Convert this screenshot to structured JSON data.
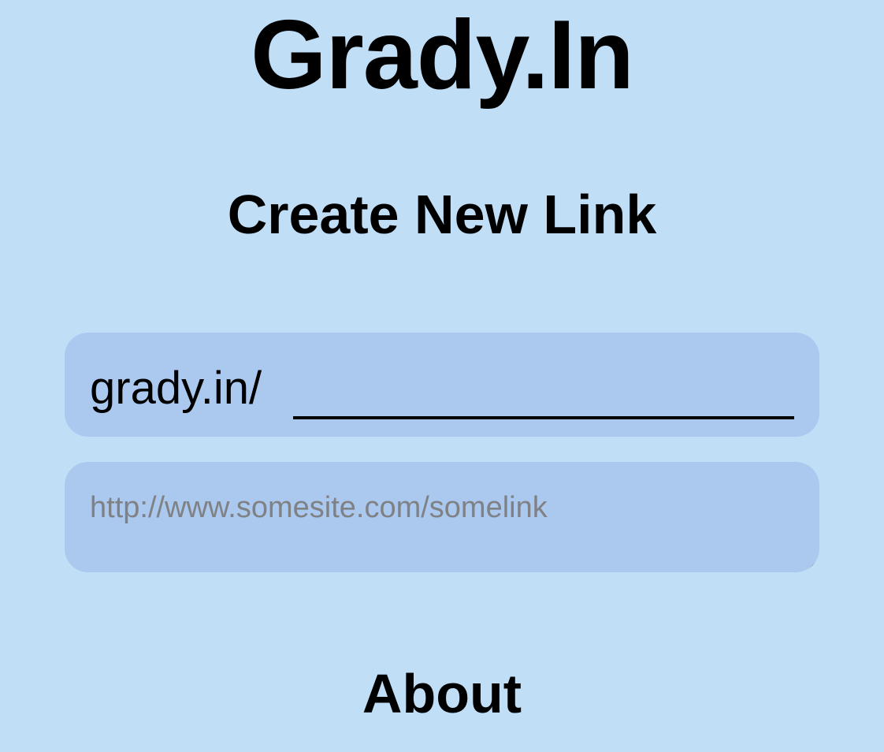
{
  "header": {
    "site_title": "Grady.In"
  },
  "create_form": {
    "heading": "Create New Link",
    "slug_prefix": "grady.in/",
    "slug_value": "",
    "url_placeholder": "http://www.somesite.com/somelink",
    "url_value": ""
  },
  "footer": {
    "about_label": "About"
  },
  "colors": {
    "background": "#c1def7",
    "field_background": "#abc8ee",
    "text": "#000000",
    "placeholder": "#7f8185"
  }
}
